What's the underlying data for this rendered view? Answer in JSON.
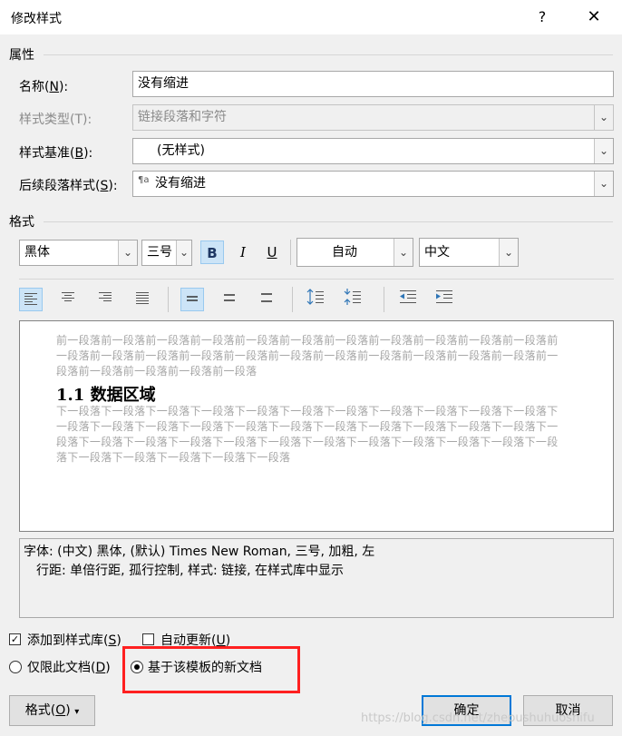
{
  "dialog": {
    "title": "修改样式",
    "help_label": "?",
    "close_label": "✕"
  },
  "properties": {
    "section_label": "属性",
    "name_label": "名称(N):",
    "name_value": "没有缩进",
    "style_type_label": "样式类型(T):",
    "style_type_value": "链接段落和字符",
    "based_on_label": "样式基准(B):",
    "based_on_value": "(无样式)",
    "following_label": "后续段落样式(S):",
    "following_icon": "¶a",
    "following_value": "没有缩进"
  },
  "format": {
    "section_label": "格式",
    "font_value": "黑体",
    "size_value": "三号",
    "bold_label": "B",
    "italic_label": "I",
    "underline_label": "U",
    "color_value": "自动",
    "script_value": "中文"
  },
  "preview": {
    "previous_text": "前一段落前一段落前一段落前一段落前一段落前一段落前一段落前一段落前一段落前一段落前一段落前一段落前一段落前一段落前一段落前一段落前一段落前一段落前一段落前一段落前一段落前一段落前一段落前一段落前一段落前一段落前一段落",
    "heading_text": "1.1  数据区域",
    "next_text": "下一段落下一段落下一段落下一段落下一段落下一段落下一段落下一段落下一段落下一段落下一段落下一段落下一段落下一段落下一段落下一段落下一段落下一段落下一段落下一段落下一段落下一段落下一段落下一段落下一段落下一段落下一段落下一段落下一段落下一段落下一段落下一段落下一段落下一段落下一段落下一段落下一段落下一段落下一段落"
  },
  "description": {
    "line1": "字体: (中文) 黑体, (默认) Times New Roman, 三号, 加粗, 左",
    "line2": "行距: 单倍行距, 孤行控制, 样式: 链接, 在样式库中显示"
  },
  "options": {
    "add_to_gallery_label": "添加到样式库(S)",
    "add_to_gallery_checked": true,
    "auto_update_label": "自动更新(U)",
    "auto_update_checked": false,
    "only_this_doc_label": "仅限此文档(D)",
    "new_docs_label": "基于该模板的新文档",
    "selected_scope": "new_docs"
  },
  "buttons": {
    "format_label": "格式(O)",
    "ok_label": "确定",
    "cancel_label": "取消"
  },
  "watermark": "https://blog.csdn.net/zhepushuhuoshifu",
  "colors": {
    "highlight_box": "#ff2020",
    "active_button": "#cce4f7",
    "default_button_border": "#0078d7"
  }
}
